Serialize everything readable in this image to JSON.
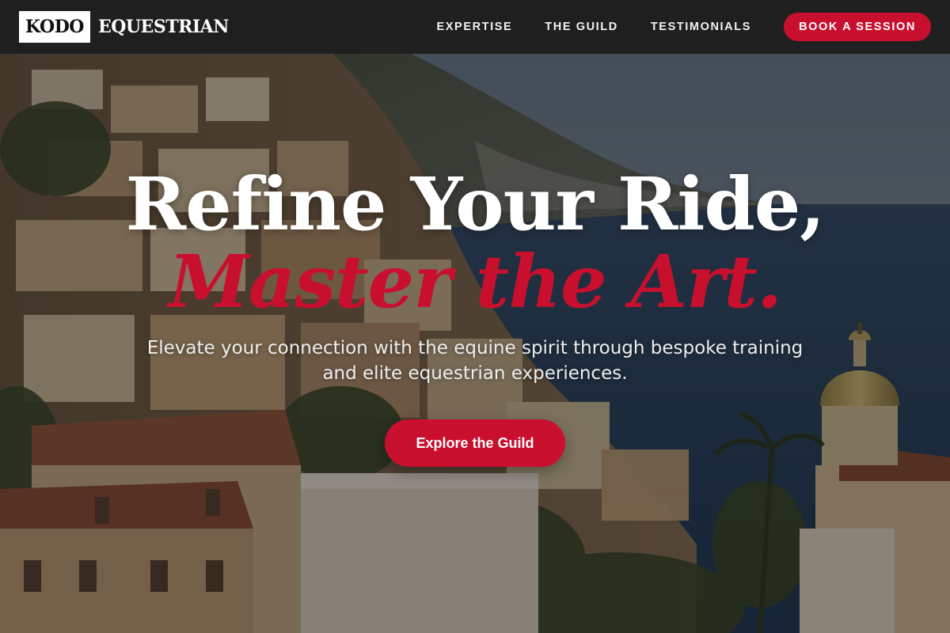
{
  "brand": {
    "logo_box_text": "KODO",
    "logo_word": "EQUESTRIAN"
  },
  "nav": {
    "links": [
      {
        "label": "EXPERTISE"
      },
      {
        "label": "THE GUILD"
      },
      {
        "label": "TESTIMONIALS"
      }
    ],
    "cta_label": "BOOK A SESSION"
  },
  "hero": {
    "headline_line1": "Refine Your Ride,",
    "headline_line2": "Master the Art.",
    "subtitle": "Elevate your connection with the equine spirit through bespoke training and elite equestrian experiences.",
    "cta_label": "Explore the Guild",
    "background_image": "coastal-hillside-village-photo"
  },
  "colors": {
    "accent": "#c8102e",
    "navbar_bg": "#1f1f1f",
    "headline_text": "#ffffff"
  }
}
